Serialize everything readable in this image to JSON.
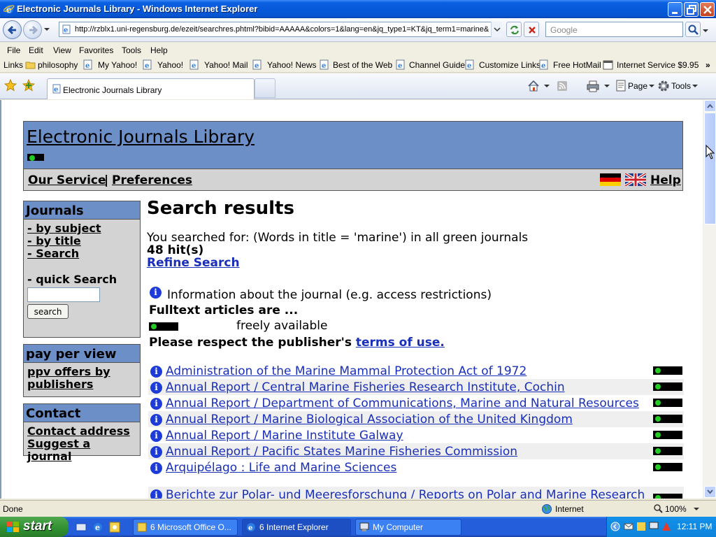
{
  "window": {
    "title": "Electronic Journals Library - Windows Internet Explorer",
    "url": "http://rzblx1.uni-regensburg.de/ezeit/searchres.phtml?bibid=AAAAA&colors=1&lang=en&jq_type1=KT&jq_term1=marine&",
    "search_placeholder": "Google"
  },
  "menu": [
    "File",
    "Edit",
    "View",
    "Favorites",
    "Tools",
    "Help"
  ],
  "links": {
    "label": "Links",
    "items": [
      "philosophy",
      "My Yahoo!",
      "Yahoo!",
      "Yahoo! Mail",
      "Yahoo! News",
      "Best of the Web",
      "Channel Guide",
      "Customize Links",
      "Free HotMail",
      "Internet Service $9.95"
    ]
  },
  "tab": {
    "label": "Electronic Journals Library"
  },
  "commands": {
    "page": "Page",
    "tools": "Tools"
  },
  "site": {
    "title": "Electronic Journals Library",
    "nav": {
      "service": "Our Service",
      "separator": "|",
      "preferences": "Preferences",
      "help": "Help"
    }
  },
  "sidebar": {
    "journals": {
      "heading": "Journals",
      "links": [
        "- by subject",
        "- by title",
        "- Search"
      ],
      "quick_search": "- quick Search",
      "button": "search"
    },
    "ppv": {
      "heading": "pay per view",
      "link": "ppv offers by publishers"
    },
    "contact": {
      "heading": "Contact",
      "links": [
        "Contact address",
        "Suggest a journal"
      ]
    }
  },
  "main": {
    "heading": "Search results",
    "query": "You searched for: (Words in title = 'marine') in all green journals",
    "hits": "48 hit(s)",
    "refine": "Refine Search",
    "info_text": "Information about the journal (e.g. access restrictions)",
    "fulltext_heading": "Fulltext articles are ...",
    "freely_available": "freely available",
    "respect_prefix": "Please respect the publisher's ",
    "terms": "terms of use."
  },
  "results": [
    "Administration of the Marine Mammal Protection Act of 1972",
    "Annual Report / Central Marine Fisheries Research Institute, Cochin",
    "Annual Report / Department of Communications, Marine and Natural Resources",
    "Annual Report / Marine Biological Association of the United Kingdom",
    "Annual Report / Marine Institute Galway",
    "Annual Report / Pacific States Marine Fisheries Commission",
    "Arquipélago : Life and Marine Sciences",
    "Berichte zur Polar- und Meeresforschung / Reports on Polar and Marine Research"
  ],
  "status": {
    "text": "Done",
    "zone": "Internet",
    "zoom": "100%"
  },
  "taskbar": {
    "start": "start",
    "tasks": [
      "6 Microsoft Office O...",
      "6 Internet Explorer",
      "My Computer"
    ],
    "clock": "12:11 PM"
  },
  "colors": {
    "header_blue": "#6b8fc6",
    "panel_grey": "#d3d3d3",
    "link_blue": "#1a2fb8",
    "available_green": "#22cc22"
  }
}
